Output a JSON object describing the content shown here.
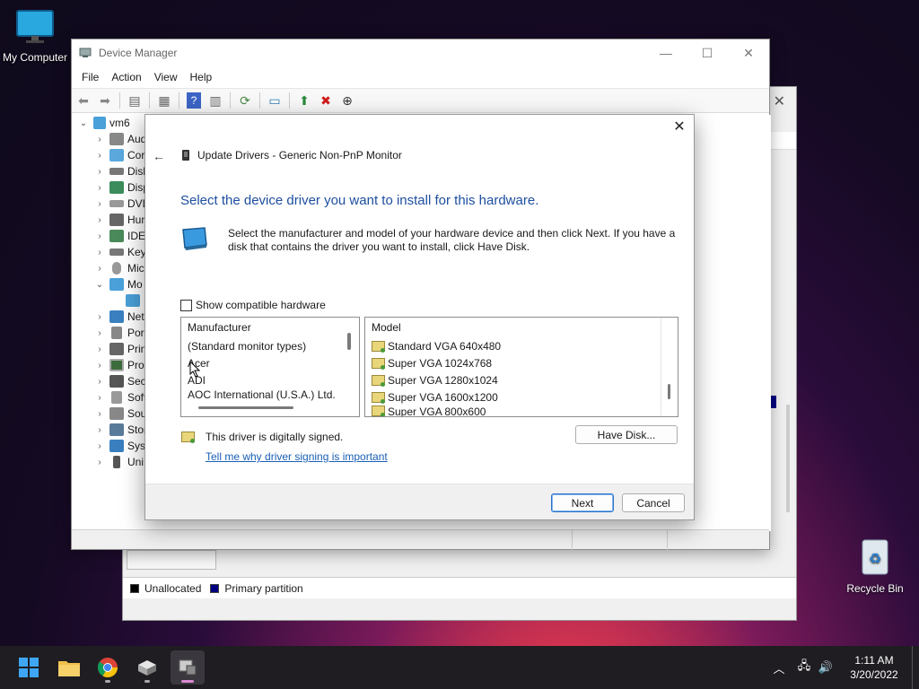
{
  "desktop": {
    "my_computer": "My Computer",
    "recycle_bin": "Recycle Bin"
  },
  "bg_window": {
    "legend": [
      {
        "label": "Unallocated",
        "color": "#000000"
      },
      {
        "label": "Primary partition",
        "color": "#000080"
      }
    ]
  },
  "device_manager": {
    "title": "Device Manager",
    "menu": [
      "File",
      "Action",
      "View",
      "Help"
    ],
    "tree_root": "vm6",
    "tree_items": [
      "Aud",
      "Cor",
      "Disk",
      "Disp",
      "DVD",
      "Hum",
      "IDE",
      "Key",
      "Mic",
      "Mo",
      "",
      "Net",
      "Por",
      "Prin",
      "Pro",
      "Sec",
      "Soft",
      "Sou",
      "Stor",
      "Syst",
      "Uni"
    ]
  },
  "dialog": {
    "window_title": "Update Drivers - Generic Non-PnP Monitor",
    "heading": "Select the device driver you want to install for this hardware.",
    "description": "Select the manufacturer and model of your hardware device and then click Next. If you have a disk that contains the driver you want to install, click Have Disk.",
    "show_compatible_label": "Show compatible hardware",
    "manufacturer_header": "Manufacturer",
    "manufacturers": [
      "(Standard monitor types)",
      "Acer",
      "ADI",
      "AOC International (U.S.A.) Ltd."
    ],
    "model_header": "Model",
    "models": [
      "Standard VGA 640x480",
      "Super VGA 1024x768",
      "Super VGA 1280x1024",
      "Super VGA 1600x1200",
      "Super VGA 800x600"
    ],
    "signed_text": "This driver is digitally signed.",
    "signing_link": "Tell me why driver signing is important",
    "have_disk_label": "Have Disk...",
    "next_label": "Next",
    "cancel_label": "Cancel"
  },
  "taskbar": {
    "time": "1:11 AM",
    "date": "3/20/2022"
  }
}
